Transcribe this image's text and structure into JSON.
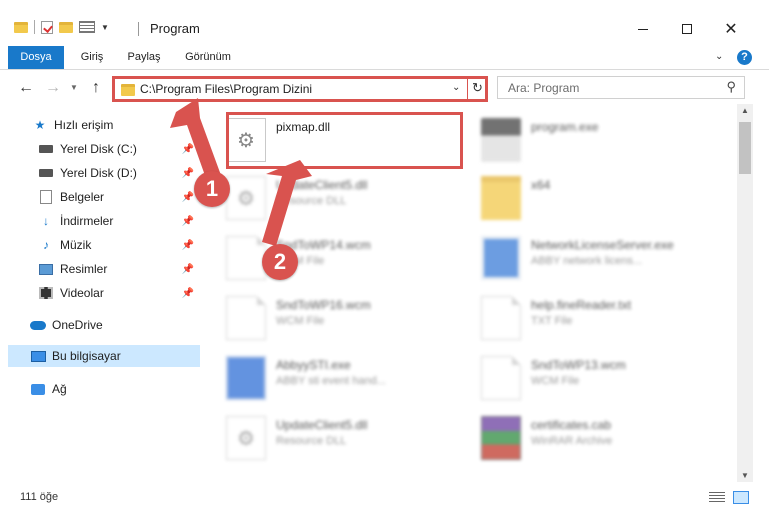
{
  "window": {
    "title": "Program",
    "controls": {
      "minimize": "",
      "maximize": "",
      "close": "✕"
    }
  },
  "ribbon": {
    "tabs": [
      "Dosya",
      "Giriş",
      "Paylaş",
      "Görünüm"
    ],
    "help": "?"
  },
  "nav": {
    "back": "←",
    "forward": "→",
    "up": "↑",
    "address": "C:\\Program Files\\Program Dizini",
    "search_placeholder": "Ara: Program"
  },
  "sidebar": {
    "items": [
      {
        "label": "Hızlı erişim",
        "icon": "star-icon"
      },
      {
        "label": "Yerel Disk (C:)",
        "icon": "drive-icon",
        "pinned": true
      },
      {
        "label": "Yerel Disk (D:)",
        "icon": "drive-icon",
        "pinned": true
      },
      {
        "label": "Belgeler",
        "icon": "documents-icon",
        "pinned": true
      },
      {
        "label": "İndirmeler",
        "icon": "download-icon",
        "pinned": true
      },
      {
        "label": "Müzik",
        "icon": "music-icon",
        "pinned": true
      },
      {
        "label": "Resimler",
        "icon": "pictures-icon",
        "pinned": true
      },
      {
        "label": "Videolar",
        "icon": "videos-icon",
        "pinned": true
      },
      {
        "label": "OneDrive",
        "icon": "cloud-icon"
      },
      {
        "label": "Bu bilgisayar",
        "icon": "computer-icon",
        "selected": true
      },
      {
        "label": "Ağ",
        "icon": "network-icon"
      }
    ]
  },
  "files": {
    "left": [
      {
        "name": "pixmap.dll",
        "desc": ""
      },
      {
        "name": "UpdateClient5.dll",
        "desc": "Resource DLL"
      },
      {
        "name": "SndToWP14.wcm",
        "desc": "WCM File"
      },
      {
        "name": "SndToWP16.wcm",
        "desc": "WCM File"
      },
      {
        "name": "AbbyySTI.exe",
        "desc": "ABBY sti event hand..."
      },
      {
        "name": "UpdateClient5.dll",
        "desc": "Resource DLL"
      }
    ],
    "right": [
      {
        "name": "program.exe",
        "desc": ""
      },
      {
        "name": "x64",
        "desc": ""
      },
      {
        "name": "NetworkLicenseServer.exe",
        "desc": "ABBY network licens..."
      },
      {
        "name": "help.fineReader.txt",
        "desc": "TXT File"
      },
      {
        "name": "SndToWP13.wcm",
        "desc": "WCM File"
      },
      {
        "name": "certificates.cab",
        "desc": "WinRAR Archive"
      }
    ]
  },
  "status": {
    "count": "111 öğe"
  },
  "annotations": {
    "step1": "1",
    "step2": "2"
  },
  "colors": {
    "accent": "#1979ca",
    "annotation": "#d9534f",
    "selected": "#cce8ff"
  }
}
